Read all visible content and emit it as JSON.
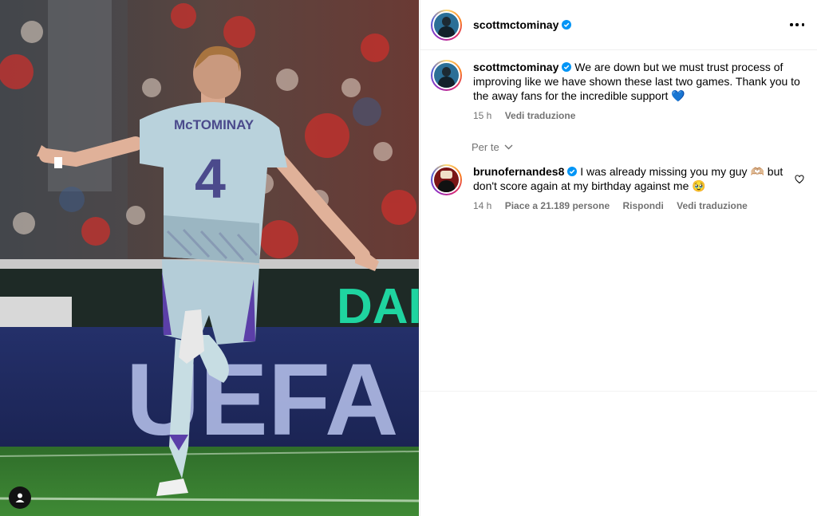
{
  "post": {
    "username": "scottmctominay",
    "caption_author": "scottmctominay",
    "caption_text": "We are down but we must trust process of improving like we have shown these last two games. Thank you to the away fans for the incredible support",
    "caption_emoji": "💙",
    "caption_time": "15 h",
    "caption_translate": "Vedi traduzione"
  },
  "filter": {
    "label": "Per te"
  },
  "comments": [
    {
      "author": "brunofernandes8",
      "text_a": "I was already missing you my guy",
      "emoji_a": "🫶🏼",
      "text_b": "but don't score again at my birthday against me",
      "emoji_b": "🥹",
      "time": "14 h",
      "likes": "Piace a 21.189 persone",
      "reply": "Rispondi",
      "translate": "Vedi traduzione"
    }
  ],
  "photo": {
    "jersey_name": "McTOMINAY",
    "jersey_number": "4",
    "board_text_top": "DAI",
    "board_text_uefa": "UEFA"
  },
  "colors": {
    "verified": "#0095f6",
    "muted": "#737373",
    "accent_board": "#1fd4a0"
  }
}
